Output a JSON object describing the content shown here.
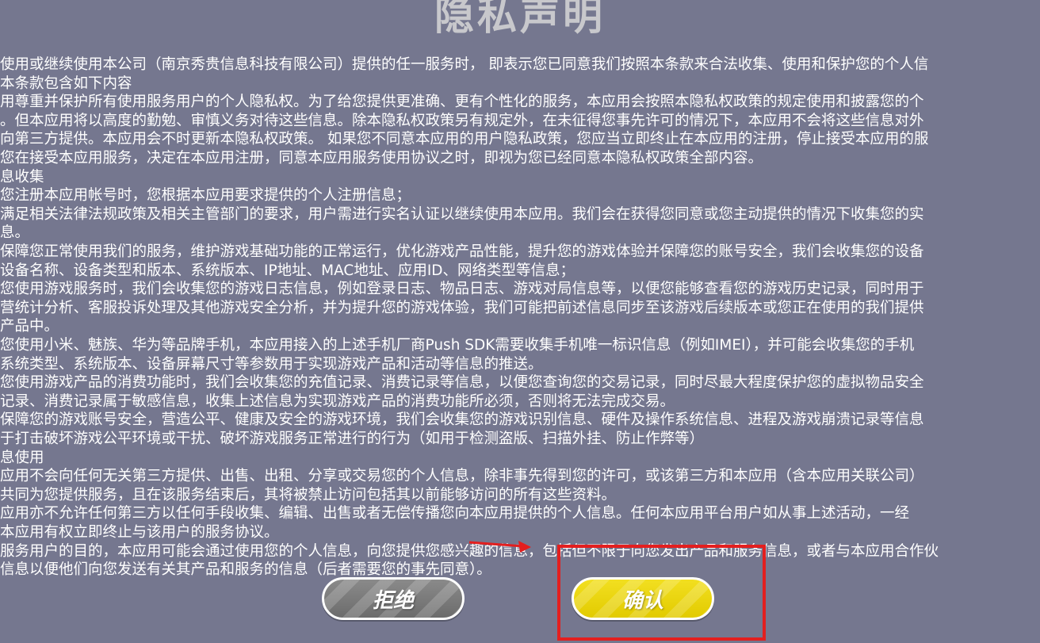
{
  "title": "隐私声明",
  "lines": [
    "使用或继续使用本公司（南京秀贵信息科技有限公司）提供的任一服务时， 即表示您已同意我们按照本条款来合法收集、使用和保护您的个人信",
    "本条款包含如下内容",
    "用尊重并保护所有使用服务用户的个人隐私权。为了给您提供更准确、更有个性化的服务，本应用会按照本隐私权政策的规定使用和披露您的个",
    "。但本应用将以高度的勤勉、审慎义务对待这些信息。除本隐私权政策另有规定外，在未征得您事先许可的情况下，本应用不会将这些信息对外",
    "向第三方提供。本应用会不时更新本隐私权政策。 如果您不同意本应用的用户隐私政策，您应当立即终止在本应用的注册，停止接受本应用的服",
    "您在接受本应用服务，决定在本应用注册，同意本应用服务使用协议之时，即视为您已经同意本隐私权政策全部内容。",
    "息收集",
    "您注册本应用帐号时，您根据本应用要求提供的个人注册信息；",
    "满足相关法律法规政策及相关主管部门的要求，用户需进行实名认证以继续使用本应用。我们会在获得您同意或您主动提供的情况下收集您的实",
    "息。",
    "保障您正常使用我们的服务，维护游戏基础功能的正常运行，优化游戏产品性能，提升您的游戏体验并保障您的账号安全，我们会收集您的设备",
    "设备名称、设备类型和版本、系统版本、IP地址、MAC地址、应用ID、网络类型等信息；",
    "您使用游戏服务时，我们会收集您的游戏日志信息，例如登录日志、物品日志、游戏对局信息等，以便您能够查看您的游戏历史记录，同时用于",
    "营统计分析、客服投诉处理及其他游戏安全分析，并为提升您的游戏体验，我们可能把前述信息同步至该游戏后续版本或您正在使用的我们提供",
    "产品中。",
    "您使用小米、魅族、华为等品牌手机，本应用接入的上述手机厂商Push SDK需要收集手机唯一标识信息（例如IMEI），并可能会收集您的手机",
    "系统类型、系统版本、设备屏幕尺寸等参数用于实现游戏产品和活动等信息的推送。",
    "您使用游戏产品的消费功能时，我们会收集您的充值记录、消费记录等信息，以便您查询您的交易记录，同时尽最大程度保护您的虚拟物品安全",
    "记录、消费记录属于敏感信息，收集上述信息为实现游戏产品的消费功能所必须，否则将无法完成交易。",
    "保障您的游戏账号安全，营造公平、健康及安全的游戏环境，我们会收集您的游戏识别信息、硬件及操作系统信息、进程及游戏崩溃记录等信息",
    "于打击破坏游戏公平环境或干扰、破坏游戏服务正常进行的行为（如用于检测盗版、扫描外挂、防止作弊等）",
    "息使用",
    "应用不会向任何无关第三方提供、出售、出租、分享或交易您的个人信息，除非事先得到您的许可，或该第三方和本应用（含本应用关联公司）",
    "共同为您提供服务，且在该服务结束后，其将被禁止访问包括其以前能够访问的所有这些资料。",
    "应用亦不允许任何第三方以任何手段收集、编辑、出售或者无偿传播您向本应用提供的个人信息。任何本应用平台用户如从事上述活动，一经",
    "本应用有权立即终止与该用户的服务协议。",
    "服务用户的目的，本应用可能会通过使用您的个人信息，向您提供您感兴趣的信息，包括但不限于向您发出产品和服务信息，或者与本应用合作伙",
    "信息以便他们向您发送有关其产品和服务的信息（后者需要您的事先同意）。"
  ],
  "buttons": {
    "reject": "拒绝",
    "confirm": "确认"
  },
  "colors": {
    "background": "#75778f",
    "title": "#c8c8cc",
    "reject_button": "#7a7a7a",
    "confirm_button": "#e9d40c",
    "highlight": "#e31f1f"
  }
}
